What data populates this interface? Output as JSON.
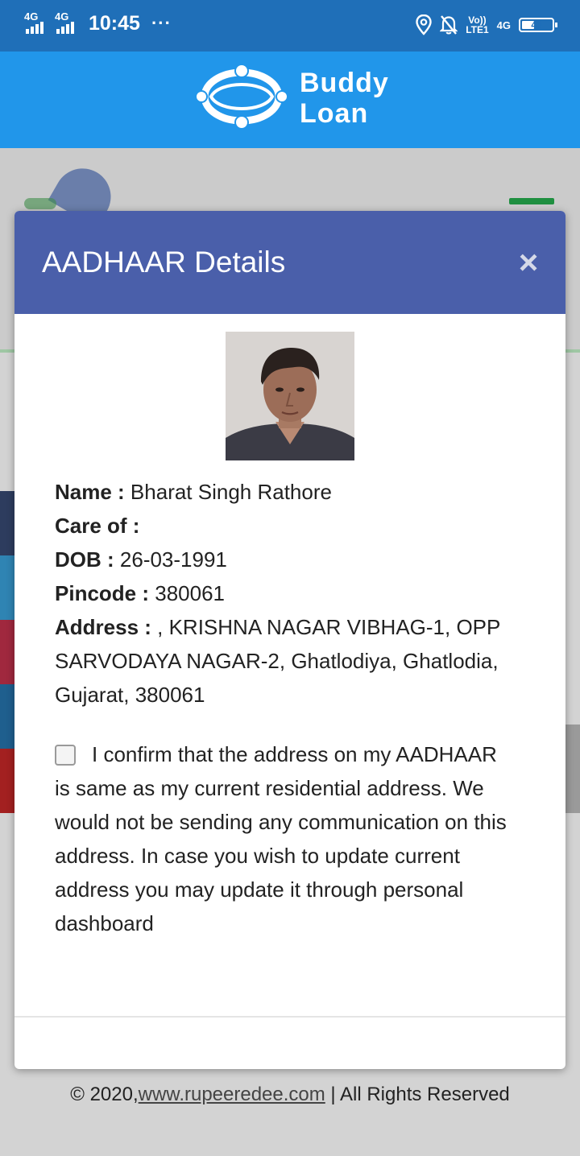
{
  "status_bar": {
    "sim1_network": "4G",
    "sim2_network": "4G",
    "time": "10:45",
    "more": "···",
    "volte_top": "Vo))",
    "volte_bottom": "LTE1",
    "network": "4G",
    "battery": "40"
  },
  "brand": {
    "line1": "Buddy",
    "line2": "Loan"
  },
  "modal": {
    "title": "AADHAAR Details",
    "close": "×",
    "details": {
      "name_label": "Name :",
      "name_value": " Bharat Singh Rathore",
      "careof_label": "Care of :",
      "careof_value": "",
      "dob_label": "DOB :",
      "dob_value": " 26-03-1991",
      "pincode_label": "Pincode :",
      "pincode_value": " 380061",
      "address_label": "Address :",
      "address_value": " , KRISHNA NAGAR VIBHAG-1, OPP SARVODAYA NAGAR-2, Ghatlodiya, Ghatlodia, Gujarat, 380061"
    },
    "confirm_text": "I confirm that the address on my AADHAAR is same as my current residential address. We would not be sending any communication on this address. In case you wish to update current address you may update it through personal dashboard"
  },
  "footer": {
    "prefix": "© 2020,",
    "link": "www.rupeeredee.com",
    "suffix": " | All Rights Reserved"
  },
  "colors": {
    "status_bar": "#1f6fb8",
    "app_bar": "#2196ea",
    "modal_header": "#4a5faa"
  }
}
